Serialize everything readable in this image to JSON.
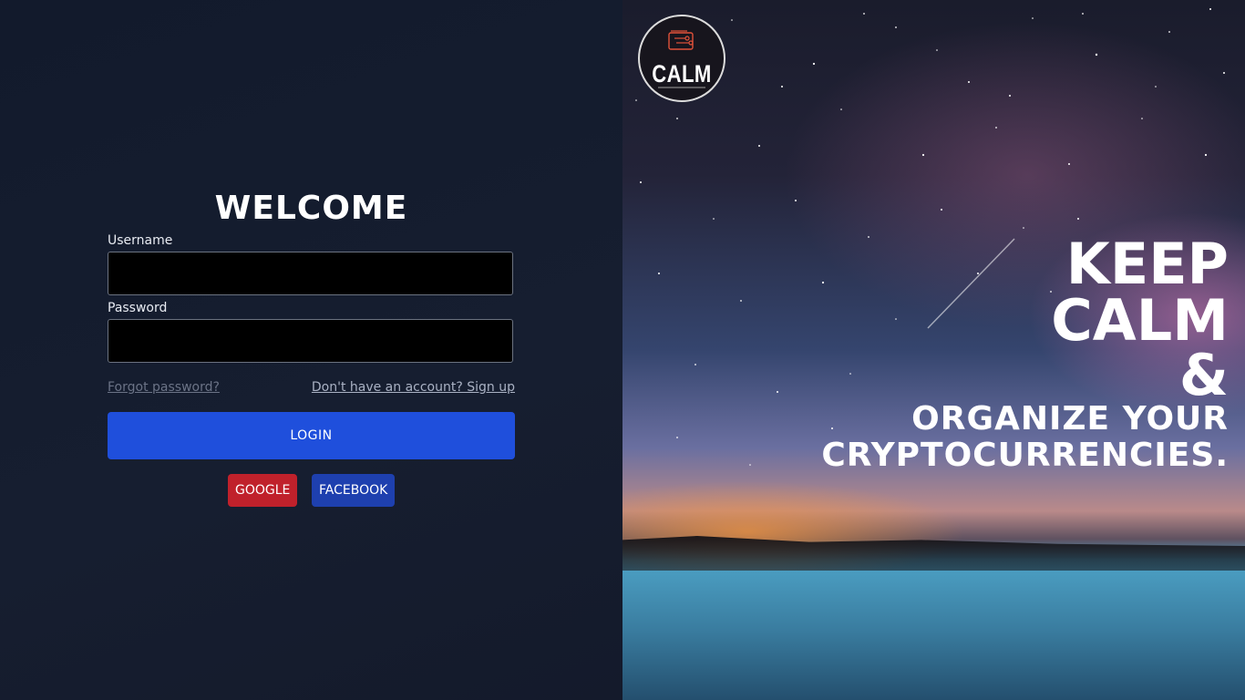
{
  "login": {
    "title": "WELCOME",
    "username_label": "Username",
    "username_value": "",
    "password_label": "Password",
    "password_value": "",
    "forgot_password": "Forgot password?",
    "signup": "Don't have an account? Sign up",
    "login_button": "LOGIN",
    "google_button": "GOOGLE",
    "facebook_button": "FACEBOOK"
  },
  "brand": {
    "logo_text": "CALM",
    "logo_icon": "wallet-circuit-icon"
  },
  "hero": {
    "line1": "KEEP",
    "line2": "CALM",
    "line3": "&",
    "line4": "ORGANIZE YOUR",
    "line5": "CRYPTOCURRENCIES."
  },
  "colors": {
    "left_panel_bg": "#141b2d",
    "login_button": "#1f4fdc",
    "google_button": "#c0212b",
    "facebook_button": "#1e40af",
    "input_bg": "#000000",
    "logo_accent": "#e0523a"
  }
}
